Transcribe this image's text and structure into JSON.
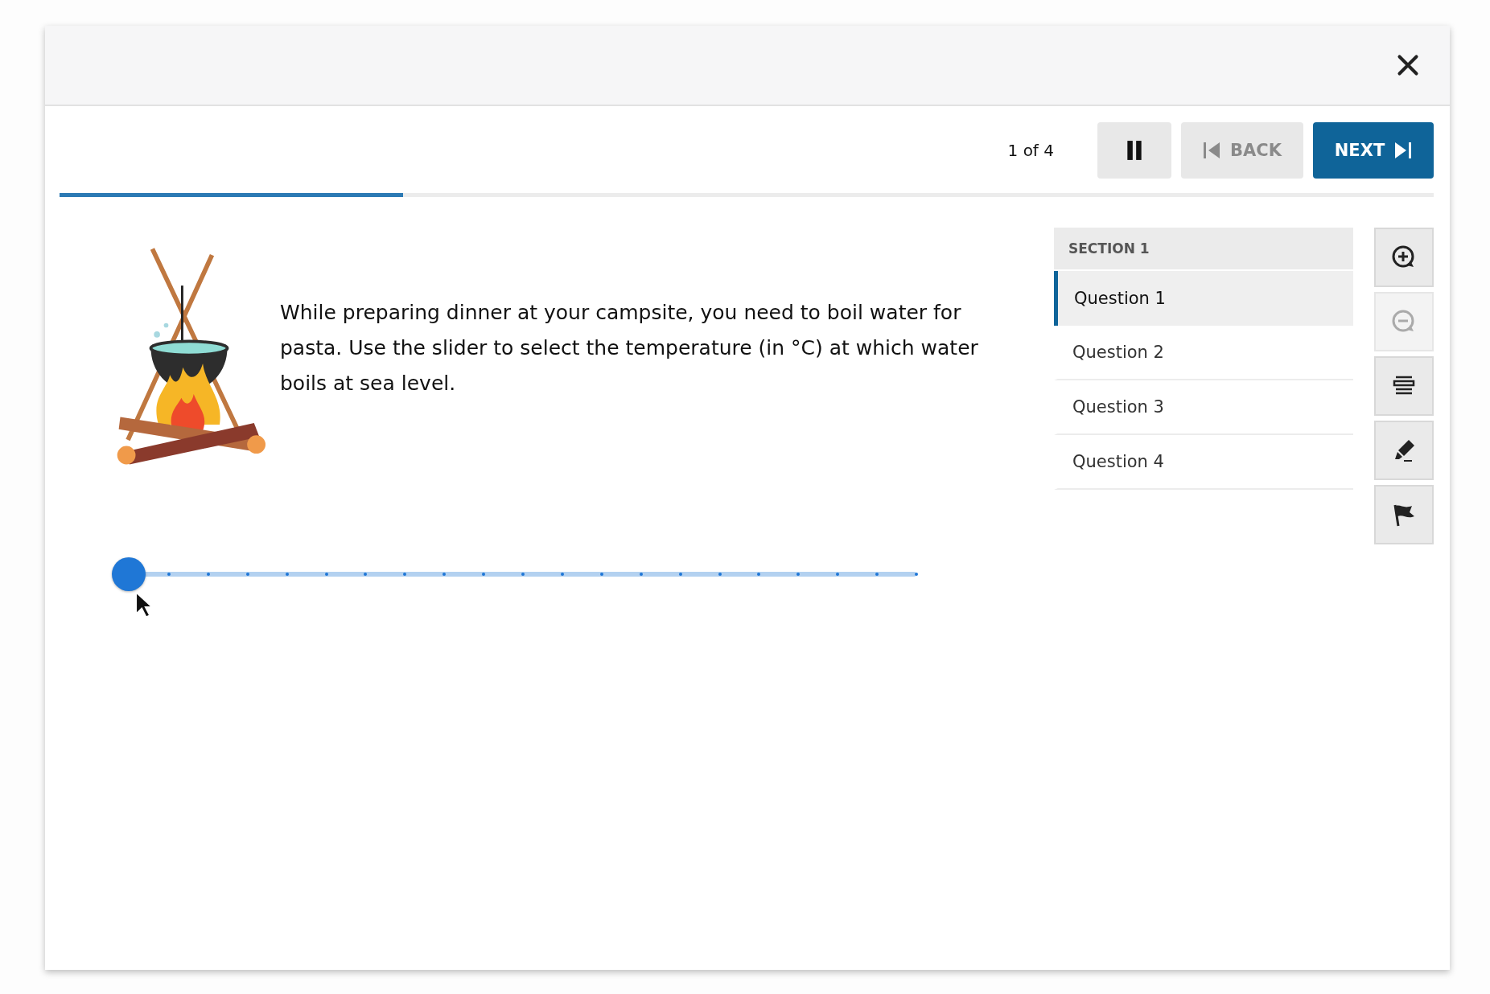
{
  "counter": "1 of 4",
  "buttons": [
    {
      "kind": "pause",
      "disabled": false
    },
    {
      "kind": "back",
      "label": "BACK",
      "disabled": true
    },
    {
      "kind": "next",
      "label": "NEXT",
      "disabled": false
    }
  ],
  "progress": {
    "level": 0.25
  },
  "question": {
    "text": "While preparing dinner at your campsite, you need to boil water for pasta. Use the slider to select the temperature (in °C) at which water boils at sea level."
  },
  "slider": {
    "level": 0
  },
  "sidebar": {
    "section": "SECTION 1",
    "items": [
      {
        "label": "Question 1",
        "selected": true
      },
      {
        "label": "Question 2",
        "selected": false
      },
      {
        "label": "Question 3",
        "selected": false
      },
      {
        "label": "Question 4",
        "selected": false
      }
    ]
  },
  "tools": [
    {
      "kind": "zoom-in",
      "disabled": false
    },
    {
      "kind": "zoom-out",
      "disabled": true
    },
    {
      "kind": "line-reader",
      "disabled": false
    },
    {
      "kind": "highlighter",
      "disabled": false
    },
    {
      "kind": "flag",
      "disabled": false
    }
  ]
}
